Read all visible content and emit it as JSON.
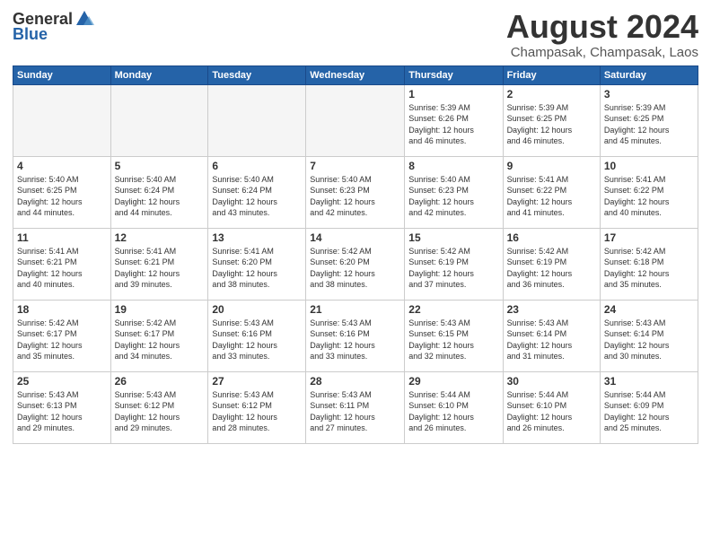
{
  "header": {
    "logo_general": "General",
    "logo_blue": "Blue",
    "month_title": "August 2024",
    "subtitle": "Champasak, Champasak, Laos"
  },
  "days_of_week": [
    "Sunday",
    "Monday",
    "Tuesday",
    "Wednesday",
    "Thursday",
    "Friday",
    "Saturday"
  ],
  "weeks": [
    [
      {
        "day": "",
        "info": ""
      },
      {
        "day": "",
        "info": ""
      },
      {
        "day": "",
        "info": ""
      },
      {
        "day": "",
        "info": ""
      },
      {
        "day": "1",
        "info": "Sunrise: 5:39 AM\nSunset: 6:26 PM\nDaylight: 12 hours\nand 46 minutes."
      },
      {
        "day": "2",
        "info": "Sunrise: 5:39 AM\nSunset: 6:25 PM\nDaylight: 12 hours\nand 46 minutes."
      },
      {
        "day": "3",
        "info": "Sunrise: 5:39 AM\nSunset: 6:25 PM\nDaylight: 12 hours\nand 45 minutes."
      }
    ],
    [
      {
        "day": "4",
        "info": "Sunrise: 5:40 AM\nSunset: 6:25 PM\nDaylight: 12 hours\nand 44 minutes."
      },
      {
        "day": "5",
        "info": "Sunrise: 5:40 AM\nSunset: 6:24 PM\nDaylight: 12 hours\nand 44 minutes."
      },
      {
        "day": "6",
        "info": "Sunrise: 5:40 AM\nSunset: 6:24 PM\nDaylight: 12 hours\nand 43 minutes."
      },
      {
        "day": "7",
        "info": "Sunrise: 5:40 AM\nSunset: 6:23 PM\nDaylight: 12 hours\nand 42 minutes."
      },
      {
        "day": "8",
        "info": "Sunrise: 5:40 AM\nSunset: 6:23 PM\nDaylight: 12 hours\nand 42 minutes."
      },
      {
        "day": "9",
        "info": "Sunrise: 5:41 AM\nSunset: 6:22 PM\nDaylight: 12 hours\nand 41 minutes."
      },
      {
        "day": "10",
        "info": "Sunrise: 5:41 AM\nSunset: 6:22 PM\nDaylight: 12 hours\nand 40 minutes."
      }
    ],
    [
      {
        "day": "11",
        "info": "Sunrise: 5:41 AM\nSunset: 6:21 PM\nDaylight: 12 hours\nand 40 minutes."
      },
      {
        "day": "12",
        "info": "Sunrise: 5:41 AM\nSunset: 6:21 PM\nDaylight: 12 hours\nand 39 minutes."
      },
      {
        "day": "13",
        "info": "Sunrise: 5:41 AM\nSunset: 6:20 PM\nDaylight: 12 hours\nand 38 minutes."
      },
      {
        "day": "14",
        "info": "Sunrise: 5:42 AM\nSunset: 6:20 PM\nDaylight: 12 hours\nand 38 minutes."
      },
      {
        "day": "15",
        "info": "Sunrise: 5:42 AM\nSunset: 6:19 PM\nDaylight: 12 hours\nand 37 minutes."
      },
      {
        "day": "16",
        "info": "Sunrise: 5:42 AM\nSunset: 6:19 PM\nDaylight: 12 hours\nand 36 minutes."
      },
      {
        "day": "17",
        "info": "Sunrise: 5:42 AM\nSunset: 6:18 PM\nDaylight: 12 hours\nand 35 minutes."
      }
    ],
    [
      {
        "day": "18",
        "info": "Sunrise: 5:42 AM\nSunset: 6:17 PM\nDaylight: 12 hours\nand 35 minutes."
      },
      {
        "day": "19",
        "info": "Sunrise: 5:42 AM\nSunset: 6:17 PM\nDaylight: 12 hours\nand 34 minutes."
      },
      {
        "day": "20",
        "info": "Sunrise: 5:43 AM\nSunset: 6:16 PM\nDaylight: 12 hours\nand 33 minutes."
      },
      {
        "day": "21",
        "info": "Sunrise: 5:43 AM\nSunset: 6:16 PM\nDaylight: 12 hours\nand 33 minutes."
      },
      {
        "day": "22",
        "info": "Sunrise: 5:43 AM\nSunset: 6:15 PM\nDaylight: 12 hours\nand 32 minutes."
      },
      {
        "day": "23",
        "info": "Sunrise: 5:43 AM\nSunset: 6:14 PM\nDaylight: 12 hours\nand 31 minutes."
      },
      {
        "day": "24",
        "info": "Sunrise: 5:43 AM\nSunset: 6:14 PM\nDaylight: 12 hours\nand 30 minutes."
      }
    ],
    [
      {
        "day": "25",
        "info": "Sunrise: 5:43 AM\nSunset: 6:13 PM\nDaylight: 12 hours\nand 29 minutes."
      },
      {
        "day": "26",
        "info": "Sunrise: 5:43 AM\nSunset: 6:12 PM\nDaylight: 12 hours\nand 29 minutes."
      },
      {
        "day": "27",
        "info": "Sunrise: 5:43 AM\nSunset: 6:12 PM\nDaylight: 12 hours\nand 28 minutes."
      },
      {
        "day": "28",
        "info": "Sunrise: 5:43 AM\nSunset: 6:11 PM\nDaylight: 12 hours\nand 27 minutes."
      },
      {
        "day": "29",
        "info": "Sunrise: 5:44 AM\nSunset: 6:10 PM\nDaylight: 12 hours\nand 26 minutes."
      },
      {
        "day": "30",
        "info": "Sunrise: 5:44 AM\nSunset: 6:10 PM\nDaylight: 12 hours\nand 26 minutes."
      },
      {
        "day": "31",
        "info": "Sunrise: 5:44 AM\nSunset: 6:09 PM\nDaylight: 12 hours\nand 25 minutes."
      }
    ]
  ]
}
